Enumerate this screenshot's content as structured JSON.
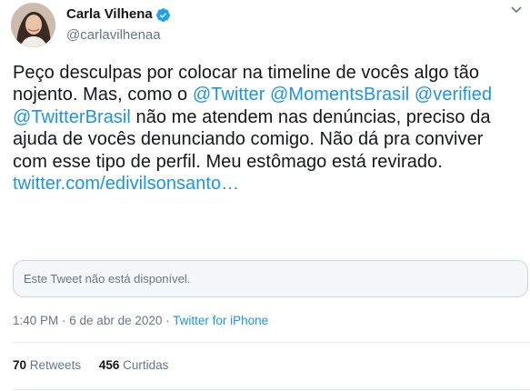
{
  "author": {
    "display_name": "Carla Vilhena",
    "handle": "@carlavilhenaa",
    "verified": true
  },
  "tweet": {
    "text_1": "Peço desculpas por colocar na timeline de vocês algo tão nojento. Mas, como o ",
    "mention_1": "@Twitter",
    "mention_2": "@MomentsBrasil",
    "mention_3": "@verified",
    "mention_4": "@TwitterBrasil",
    "text_2": " não me atendem nas denúncias, preciso da ajuda de vocês denunciando comigo. Não dá pra conviver com esse tipo de perfil. Meu estômago está revirado.",
    "link": "twitter.com/edivilsonsanto…"
  },
  "quote": {
    "unavailable_text": "Este Tweet não está disponível."
  },
  "meta": {
    "time": "1:40 PM",
    "separator": " · ",
    "date": "6 de abr de 2020",
    "source": "Twitter for iPhone"
  },
  "stats": {
    "retweets_count": "70",
    "retweets_label": "Retweets",
    "likes_count": "456",
    "likes_label": "Curtidas"
  },
  "colors": {
    "link": "#1b95e0",
    "secondary_text": "#657786",
    "verified_badge": "#1da1f2"
  },
  "icons": {
    "verified": "verified-badge-icon",
    "more": "chevron-down-icon"
  }
}
